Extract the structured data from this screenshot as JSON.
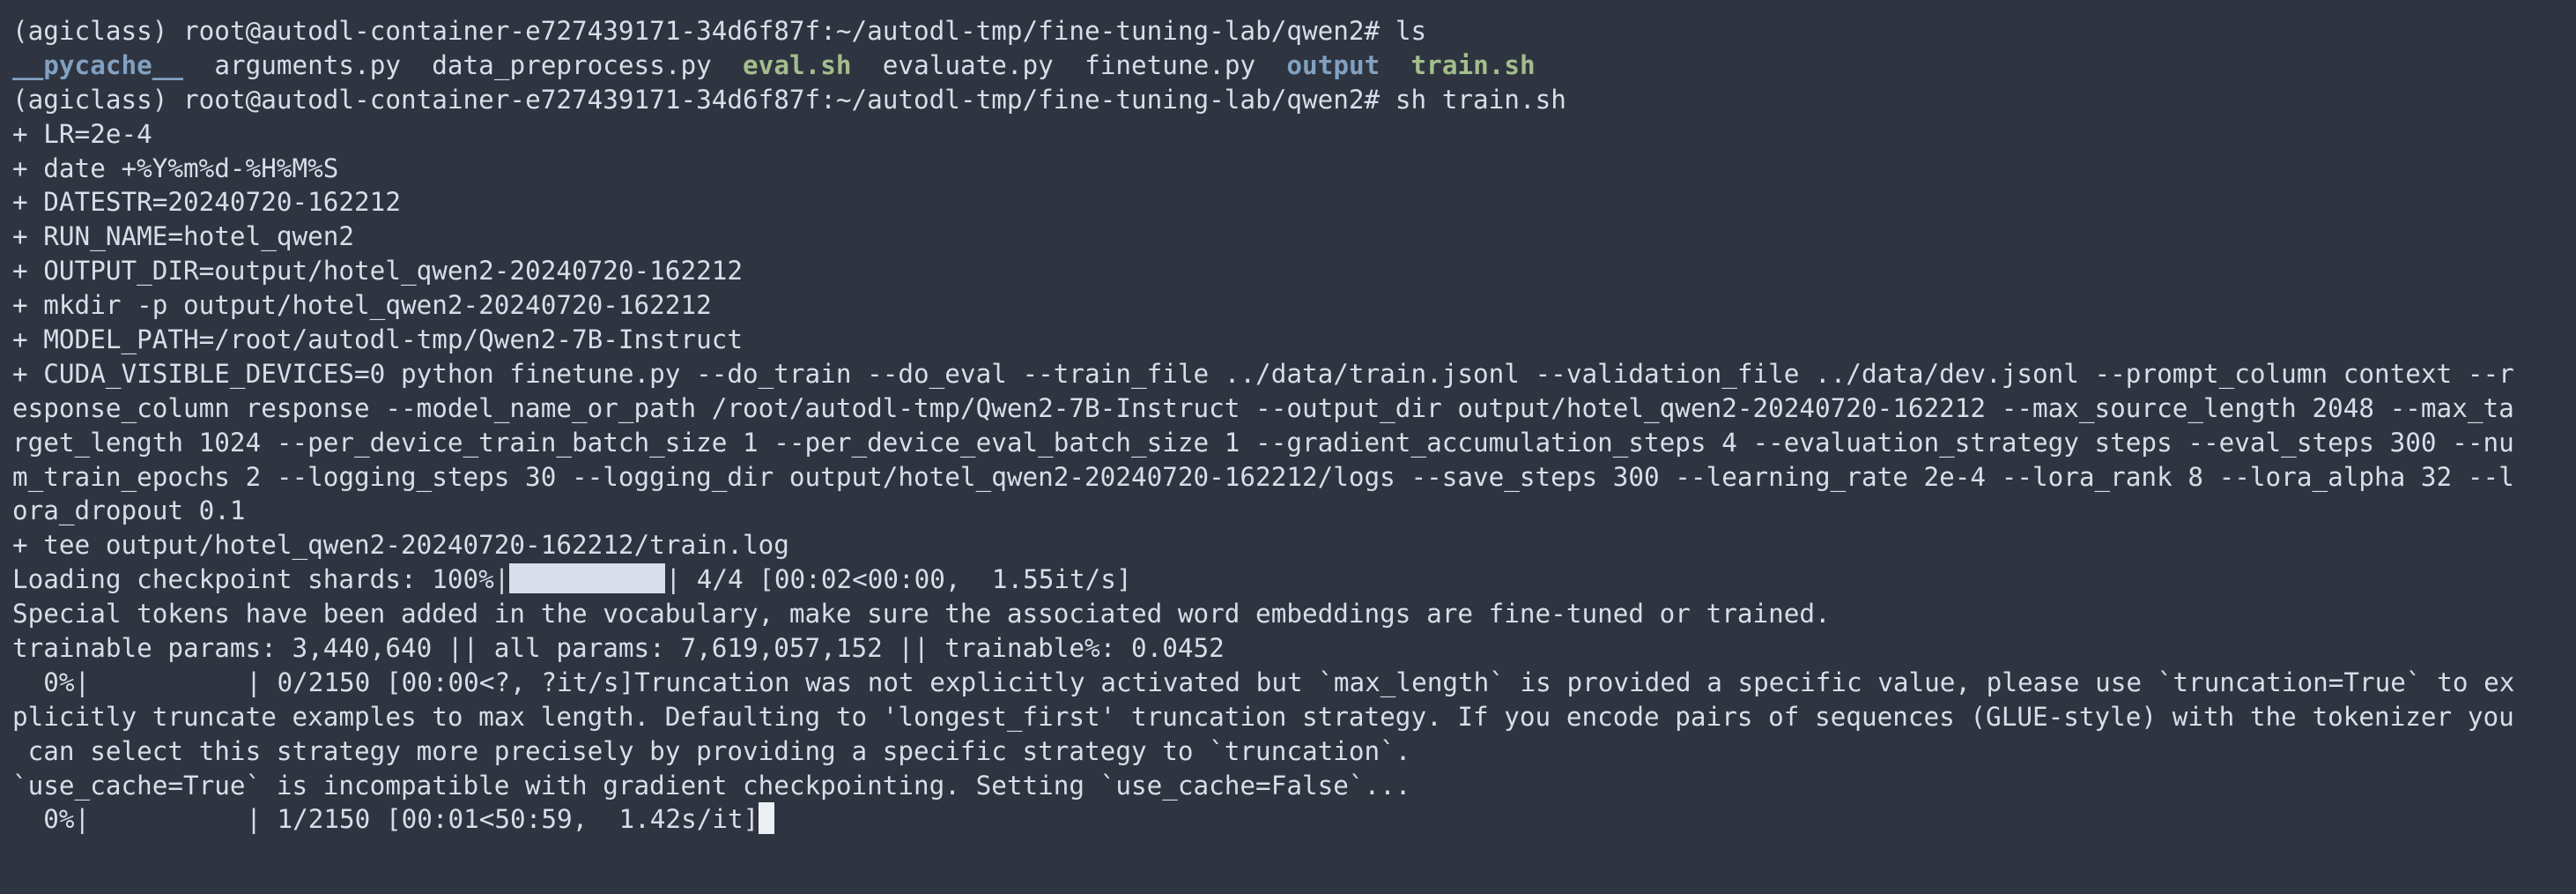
{
  "terminal": {
    "prompt_env": "(agiclass)",
    "prompt_host_path": "root@autodl-container-e727439171-34d6f87f:~/autodl-tmp/fine-tuning-lab/qwen2#",
    "cmd_ls": "ls",
    "cmd_sh": "sh train.sh",
    "ls_output": {
      "pycache": "__pycache__",
      "arguments": "arguments.py",
      "data_preprocess": "data_preprocess.py",
      "eval_sh": "eval.sh",
      "evaluate": "evaluate.py",
      "finetune": "finetune.py",
      "output": "output",
      "train_sh": "train.sh"
    },
    "trace": [
      "+ LR=2e-4",
      "+ date +%Y%m%d-%H%M%S",
      "+ DATESTR=20240720-162212",
      "+ RUN_NAME=hotel_qwen2",
      "+ OUTPUT_DIR=output/hotel_qwen2-20240720-162212",
      "+ mkdir -p output/hotel_qwen2-20240720-162212",
      "+ MODEL_PATH=/root/autodl-tmp/Qwen2-7B-Instruct"
    ],
    "cuda_cmd": [
      "+ CUDA_VISIBLE_DEVICES=0 python finetune.py --do_train --do_eval --train_file ../data/train.jsonl --validation_file ../data/dev.jsonl --prompt_column context --r",
      "esponse_column response --model_name_or_path /root/autodl-tmp/Qwen2-7B-Instruct --output_dir output/hotel_qwen2-20240720-162212 --max_source_length 2048 --max_ta",
      "rget_length 1024 --per_device_train_batch_size 1 --per_device_eval_batch_size 1 --gradient_accumulation_steps 4 --evaluation_strategy steps --eval_steps 300 --nu",
      "m_train_epochs 2 --logging_steps 30 --logging_dir output/hotel_qwen2-20240720-162212/logs --save_steps 300 --learning_rate 2e-4 --lora_rank 8 --lora_alpha 32 --l",
      "ora_dropout 0.1"
    ],
    "tee_cmd": "+ tee output/hotel_qwen2-20240720-162212/train.log",
    "loading": {
      "prefix": "Loading checkpoint shards: 100%|",
      "suffix": "| 4/4 [00:02<00:00,  1.55it/s]",
      "progress": 1.0
    },
    "special_tokens": "Special tokens have been added in the vocabulary, make sure the associated word embeddings are fine-tuned or trained.",
    "trainable": "trainable params: 3,440,640 || all params: 7,619,057,152 || trainable%: 0.0452",
    "progress0": {
      "prefix": "  0%|",
      "suffix": "| 0/2150 [00:00<?, ?it/s]Truncation was not explicitly activated but `max_length` is provided a specific value, please use `truncation=True` to ex",
      "progress": 0.0
    },
    "truncation_warning": [
      "plicitly truncate examples to max length. Defaulting to 'longest_first' truncation strategy. If you encode pairs of sequences (GLUE-style) with the tokenizer you",
      " can select this strategy more precisely by providing a specific strategy to `truncation`."
    ],
    "use_cache": "`use_cache=True` is incompatible with gradient checkpointing. Setting `use_cache=False`...",
    "progress1": {
      "prefix": "  0%|",
      "suffix": "| 1/2150 [00:01<50:59,  1.42s/it]",
      "progress": 0.0005
    },
    "colors": {
      "background": "#2e3440",
      "foreground": "#d8dee9",
      "directory": "#81a1c1",
      "executable": "#a3be8c"
    }
  }
}
